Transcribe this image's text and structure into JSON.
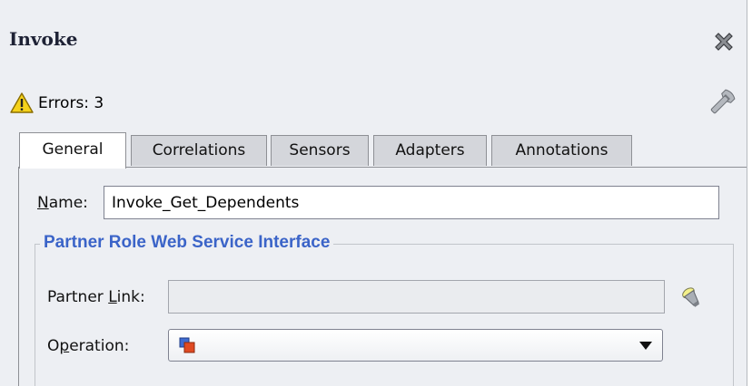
{
  "dialog": {
    "title": "Invoke",
    "errors_text": "Errors: 3"
  },
  "tabs": [
    {
      "label": "General",
      "active": true
    },
    {
      "label": "Correlations",
      "active": false
    },
    {
      "label": "Sensors",
      "active": false
    },
    {
      "label": "Adapters",
      "active": false
    },
    {
      "label": "Annotations",
      "active": false
    }
  ],
  "general": {
    "name_label_underlined": "N",
    "name_label_rest": "ame:",
    "name_value": "Invoke_Get_Dependents",
    "group_title": "Partner Role Web Service Interface",
    "partner_link_label_pre": "Partner ",
    "partner_link_label_underlined": "L",
    "partner_link_label_post": "ink:",
    "partner_link_value": "",
    "operation_label_pre": "O",
    "operation_label_underlined": "p",
    "operation_label_post": "eration:",
    "operation_value": ""
  },
  "icons": {
    "close": "close-icon",
    "warning": "warning-icon",
    "wrench": "wrench-icon",
    "flashlight": "flashlight-browse-icon",
    "operation": "operation-icon",
    "dropdown": "chevron-down-icon"
  },
  "colors": {
    "background": "#edeff3",
    "group_title": "#3b64c8",
    "tab_inactive": "#d4d6db"
  }
}
